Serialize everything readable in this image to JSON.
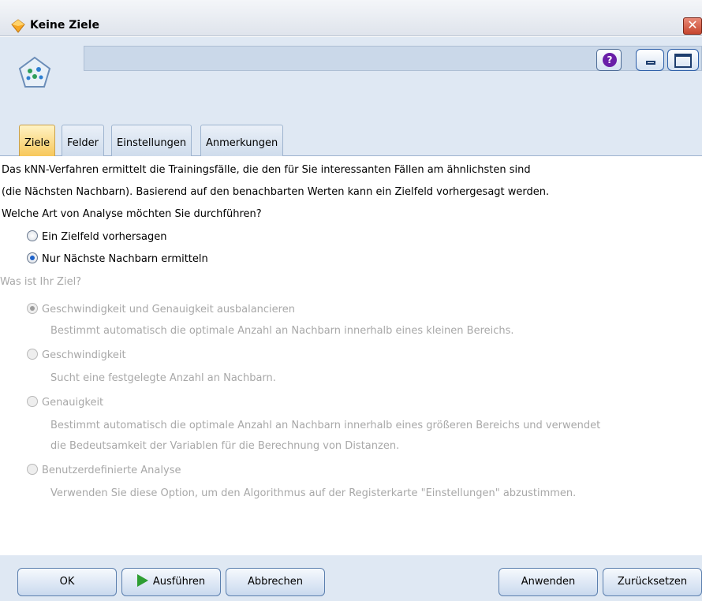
{
  "window": {
    "title": "Keine Ziele",
    "close_glyph": "✕"
  },
  "header": {
    "help_glyph": "?",
    "name_value": ""
  },
  "tabs": [
    {
      "label": "Ziele",
      "active": true
    },
    {
      "label": "Felder",
      "active": false
    },
    {
      "label": "Einstellungen",
      "active": false
    },
    {
      "label": "Anmerkungen",
      "active": false
    }
  ],
  "intro": {
    "line1": "Das kNN-Verfahren ermittelt die Trainingsfälle, die den für Sie interessanten Fällen am ähnlichsten sind",
    "line2": "(die Nächsten Nachbarn). Basierend auf den benachbarten Werten kann ein Zielfeld vorhergesagt werden.",
    "question": "Welche Art von Analyse möchten Sie durchführen?"
  },
  "analysis_options": [
    {
      "label": "Ein Zielfeld vorhersagen",
      "selected": false
    },
    {
      "label": "Nur Nächste Nachbarn ermitteln",
      "selected": true
    }
  ],
  "goal": {
    "question": "Was ist Ihr Ziel?",
    "options": [
      {
        "label": "Geschwindigkeit und Genauigkeit ausbalancieren",
        "selected": true,
        "description": [
          "Bestimmt automatisch die optimale Anzahl an Nachbarn innerhalb eines kleinen Bereichs."
        ]
      },
      {
        "label": "Geschwindigkeit",
        "selected": false,
        "description": [
          "Sucht eine festgelegte Anzahl an Nachbarn."
        ]
      },
      {
        "label": "Genauigkeit",
        "selected": false,
        "description": [
          "Bestimmt automatisch die optimale Anzahl an Nachbarn innerhalb eines größeren Bereichs und verwendet",
          "die Bedeutsamkeit der Variablen für die Berechnung von Distanzen."
        ]
      },
      {
        "label": "Benutzerdefinierte Analyse",
        "selected": false,
        "description": [
          "Verwenden Sie diese Option, um den Algorithmus auf der Registerkarte \"Einstellungen\" abzustimmen."
        ]
      }
    ]
  },
  "buttons": {
    "ok": "OK",
    "run": "Ausführen",
    "cancel": "Abbrechen",
    "apply": "Anwenden",
    "reset": "Zurücksetzen"
  },
  "colors": {
    "accent": "#1d61c9",
    "header_bg": "#dfe8f3",
    "tab_active": "#f7c75a",
    "disabled_text": "#a8a8a8"
  }
}
